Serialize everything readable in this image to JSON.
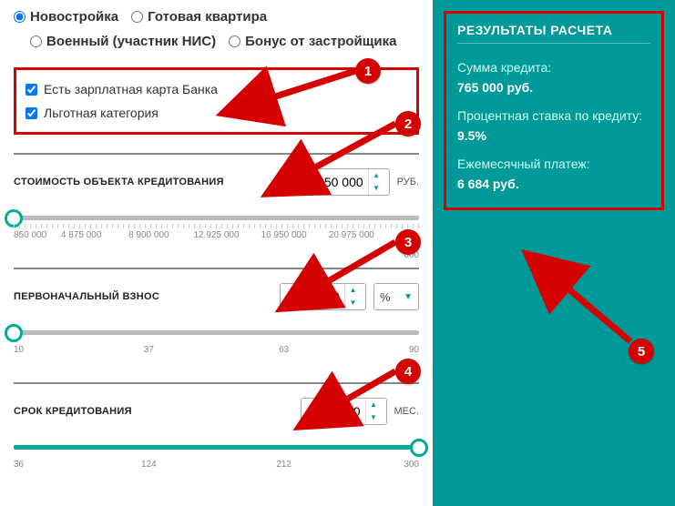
{
  "radios": {
    "new_building": "Новостройка",
    "ready_apartment": "Готовая квартира",
    "military": "Военный (участник НИС)",
    "developer_bonus": "Бонус от застройщика"
  },
  "checkboxes": {
    "salary_card": "Есть зарплатная карта Банка",
    "preferential": "Льготная категория"
  },
  "params": {
    "object_cost_label": "СТОИМОСТЬ ОБЪЕКТА КРЕДИТОВАНИЯ",
    "object_cost_value": "850 000",
    "object_cost_unit": "РУБ.",
    "object_cost_ticks": [
      "850 000",
      "4 875 000",
      "8 900 000",
      "12 925 000",
      "16 950 000",
      "20 975 000",
      "25 000 000"
    ],
    "down_payment_label": "ПЕРВОНАЧАЛЬНЫЙ ВЗНОС",
    "down_payment_value": "10",
    "down_payment_unit": "%",
    "down_payment_ticks": [
      "10",
      "37",
      "63",
      "90"
    ],
    "term_label": "СРОК КРЕДИТОВАНИЯ",
    "term_value": "300",
    "term_unit": "МЕС.",
    "term_ticks": [
      "36",
      "124",
      "212",
      "300"
    ]
  },
  "results": {
    "title": "РЕЗУЛЬТАТЫ РАСЧЕТА",
    "loan_amount_label": "Сумма кредита:",
    "loan_amount_value": "765 000 руб.",
    "rate_label": "Процентная ставка по кредиту:",
    "rate_value": "9.5%",
    "monthly_label": "Ежемесячный платеж:",
    "monthly_value": "6 684 руб."
  },
  "badges": {
    "b1": "1",
    "b2": "2",
    "b3": "3",
    "b4": "4",
    "b5": "5"
  }
}
